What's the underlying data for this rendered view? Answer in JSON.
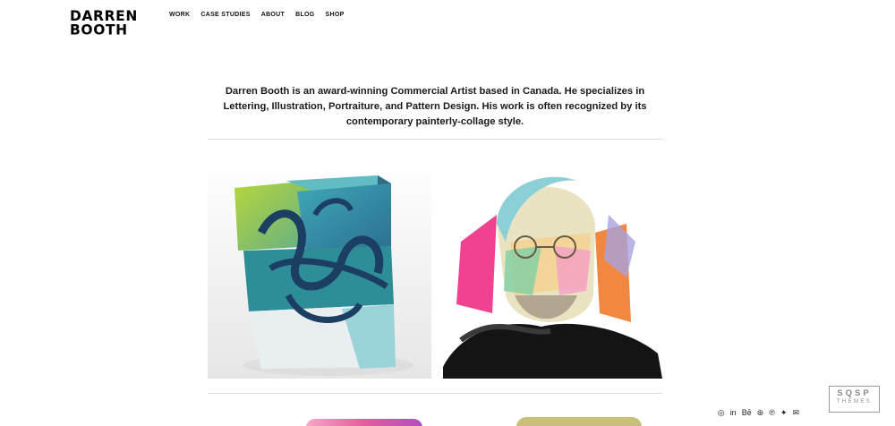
{
  "brand": {
    "line1": "DARREN",
    "line2": "BOOTH"
  },
  "nav": {
    "items": [
      {
        "label": "WORK"
      },
      {
        "label": "CASE STUDIES"
      },
      {
        "label": "ABOUT"
      },
      {
        "label": "BLOG"
      },
      {
        "label": "SHOP"
      }
    ]
  },
  "intro": {
    "text": "Darren Booth is an award-winning Commercial Artist based in Canada. He specializes in Lettering, Illustration, Portraiture, and Pattern Design. His work is often recognized by its contemporary painterly-collage style."
  },
  "gallery": {
    "items": [
      {
        "icon": "lettering-cube-artwork"
      },
      {
        "icon": "painterly-portrait-artwork"
      }
    ]
  },
  "social": {
    "icons": [
      {
        "icon": "instagram-icon",
        "glyph": "◎"
      },
      {
        "icon": "linkedin-icon",
        "glyph": "in"
      },
      {
        "icon": "behance-icon",
        "glyph": "Bē"
      },
      {
        "icon": "dribbble-icon",
        "glyph": "⊛"
      },
      {
        "icon": "pinterest-icon",
        "glyph": "℗"
      },
      {
        "icon": "twitter-icon",
        "glyph": "✦"
      },
      {
        "icon": "email-icon",
        "glyph": "✉"
      }
    ]
  },
  "badge": {
    "line1": "SQSP",
    "line2": "THEMES"
  }
}
